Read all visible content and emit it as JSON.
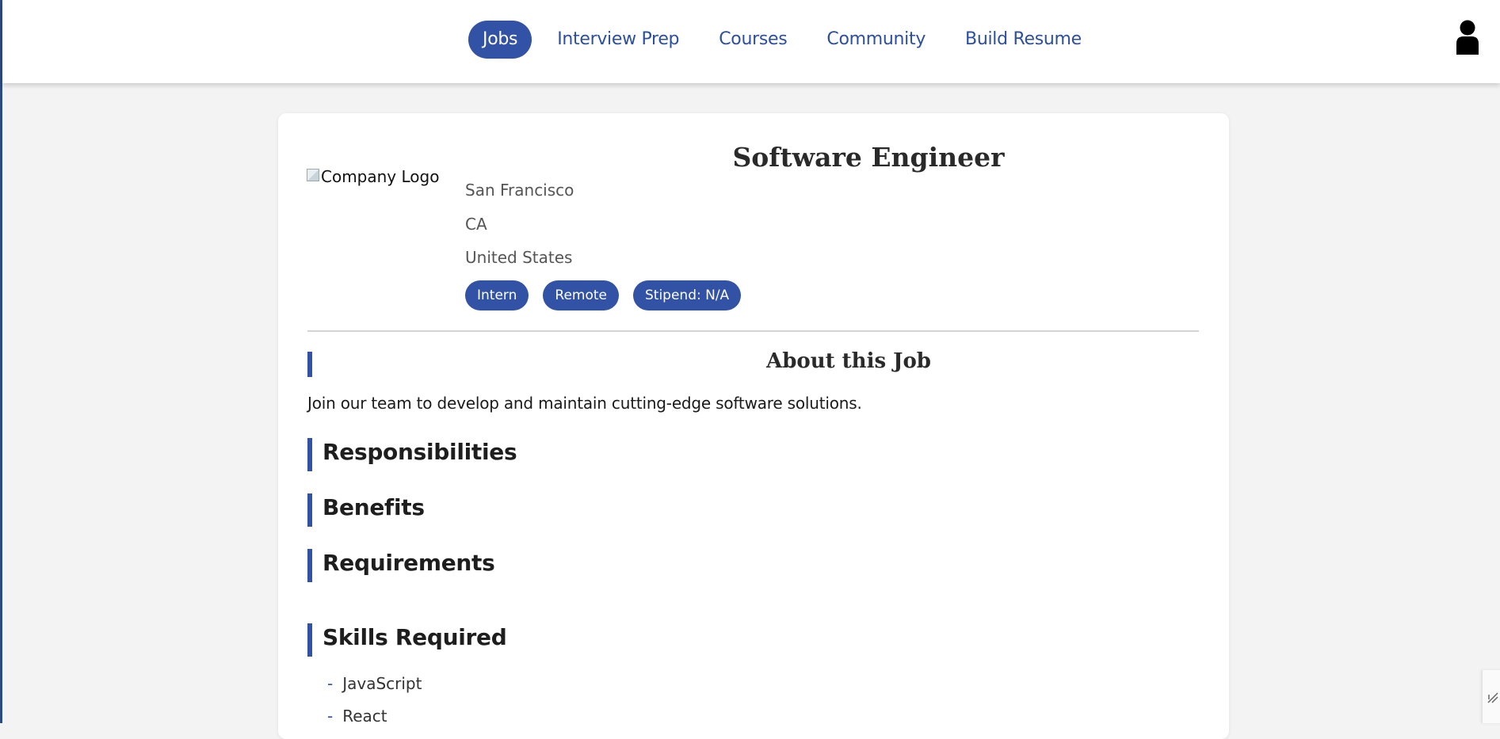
{
  "nav": {
    "items": [
      {
        "label": "Jobs",
        "active": true
      },
      {
        "label": "Interview Prep",
        "active": false
      },
      {
        "label": "Courses",
        "active": false
      },
      {
        "label": "Community",
        "active": false
      },
      {
        "label": "Build Resume",
        "active": false
      }
    ],
    "user_icon": "user-icon"
  },
  "job": {
    "title": "Software Engineer",
    "logo_alt": "Company Logo",
    "city": "San Francisco",
    "state": "CA",
    "country": "United States",
    "badges": [
      "Intern",
      "Remote",
      "Stipend: N/A"
    ]
  },
  "about": {
    "heading": "About this Job",
    "description": "Join our team to develop and maintain cutting-edge software solutions."
  },
  "sections": {
    "responsibilities": "Responsibilities",
    "benefits": "Benefits",
    "requirements": "Requirements",
    "skills": "Skills Required"
  },
  "skills": [
    "JavaScript",
    "React"
  ],
  "colors": {
    "accent": "#3152a5",
    "nav_text": "#2c4fa0",
    "background": "#f3f3f3"
  }
}
